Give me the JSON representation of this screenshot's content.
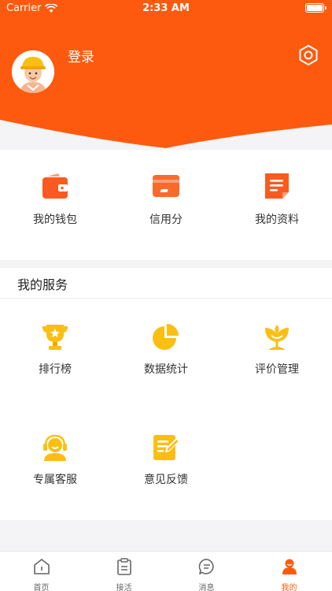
{
  "colors": {
    "accent": "#fd5a10",
    "icon_yellow": "#fbbf14",
    "icon_orange": "#fa6a2a"
  },
  "status_bar": {
    "carrier": "Carrier",
    "time": "2:33 AM"
  },
  "header": {
    "login_label": "登录"
  },
  "quick_actions": [
    {
      "label": "我的钱包",
      "icon": "wallet-icon"
    },
    {
      "label": "信用分",
      "icon": "credit-card-icon"
    },
    {
      "label": "我的资料",
      "icon": "document-icon"
    }
  ],
  "services": {
    "title": "我的服务",
    "items": [
      {
        "label": "排行榜",
        "icon": "trophy-icon"
      },
      {
        "label": "数据统计",
        "icon": "pie-chart-icon"
      },
      {
        "label": "评价管理",
        "icon": "flower-icon"
      },
      {
        "label": "专属客服",
        "icon": "headset-icon"
      },
      {
        "label": "意见反馈",
        "icon": "feedback-icon"
      }
    ]
  },
  "tabbar": {
    "tabs": [
      {
        "label": "首页",
        "icon": "home-icon"
      },
      {
        "label": "接活",
        "icon": "clipboard-icon"
      },
      {
        "label": "消息",
        "icon": "message-icon"
      },
      {
        "label": "我的",
        "icon": "person-icon",
        "active": true
      }
    ]
  }
}
